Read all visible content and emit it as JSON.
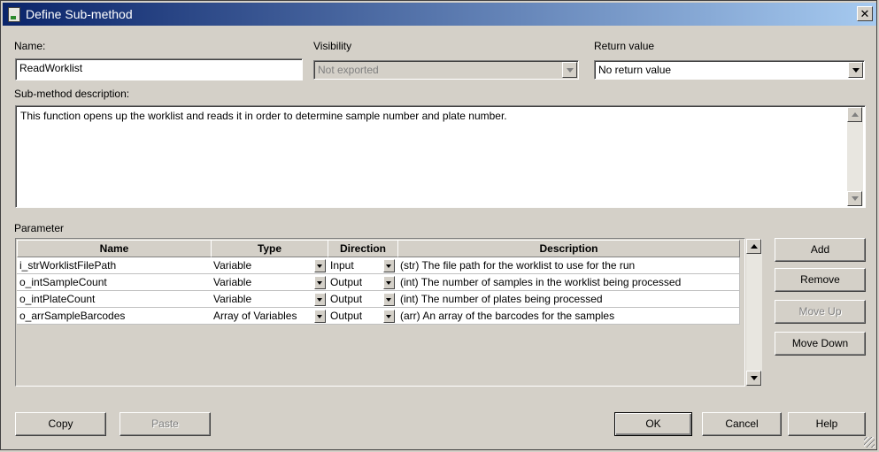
{
  "window": {
    "title": "Define Sub-method",
    "close_glyph": "✕"
  },
  "form": {
    "name_label": "Name:",
    "name_value": "ReadWorklist",
    "visibility_label": "Visibility",
    "visibility_value": "Not exported",
    "return_label": "Return value",
    "return_value": "No return value",
    "description_label": "Sub-method description:",
    "description_value": "This function opens up the worklist and reads it in order to determine sample number and plate number."
  },
  "parameters": {
    "label": "Parameter",
    "columns": [
      "Name",
      "Type",
      "Direction",
      "Description"
    ],
    "rows": [
      {
        "name": "i_strWorklistFilePath",
        "type": "Variable",
        "direction": "Input",
        "description": "(str) The file path for the worklist to use for the run"
      },
      {
        "name": "o_intSampleCount",
        "type": "Variable",
        "direction": "Output",
        "description": "(int) The number of samples in the worklist being processed"
      },
      {
        "name": "o_intPlateCount",
        "type": "Variable",
        "direction": "Output",
        "description": "(int) The number of plates being processed"
      },
      {
        "name": "o_arrSampleBarcodes",
        "type": "Array of Variables",
        "direction": "Output",
        "description": "(arr) An array of the barcodes for the samples"
      }
    ]
  },
  "side_buttons": {
    "add": "Add",
    "remove": "Remove",
    "move_up": "Move Up",
    "move_down": "Move Down"
  },
  "bottom_buttons": {
    "copy": "Copy",
    "paste": "Paste",
    "ok": "OK",
    "cancel": "Cancel",
    "help": "Help"
  },
  "colors": {
    "title_start": "#0a246a",
    "title_end": "#a6caf0",
    "face": "#d4d0c8"
  }
}
